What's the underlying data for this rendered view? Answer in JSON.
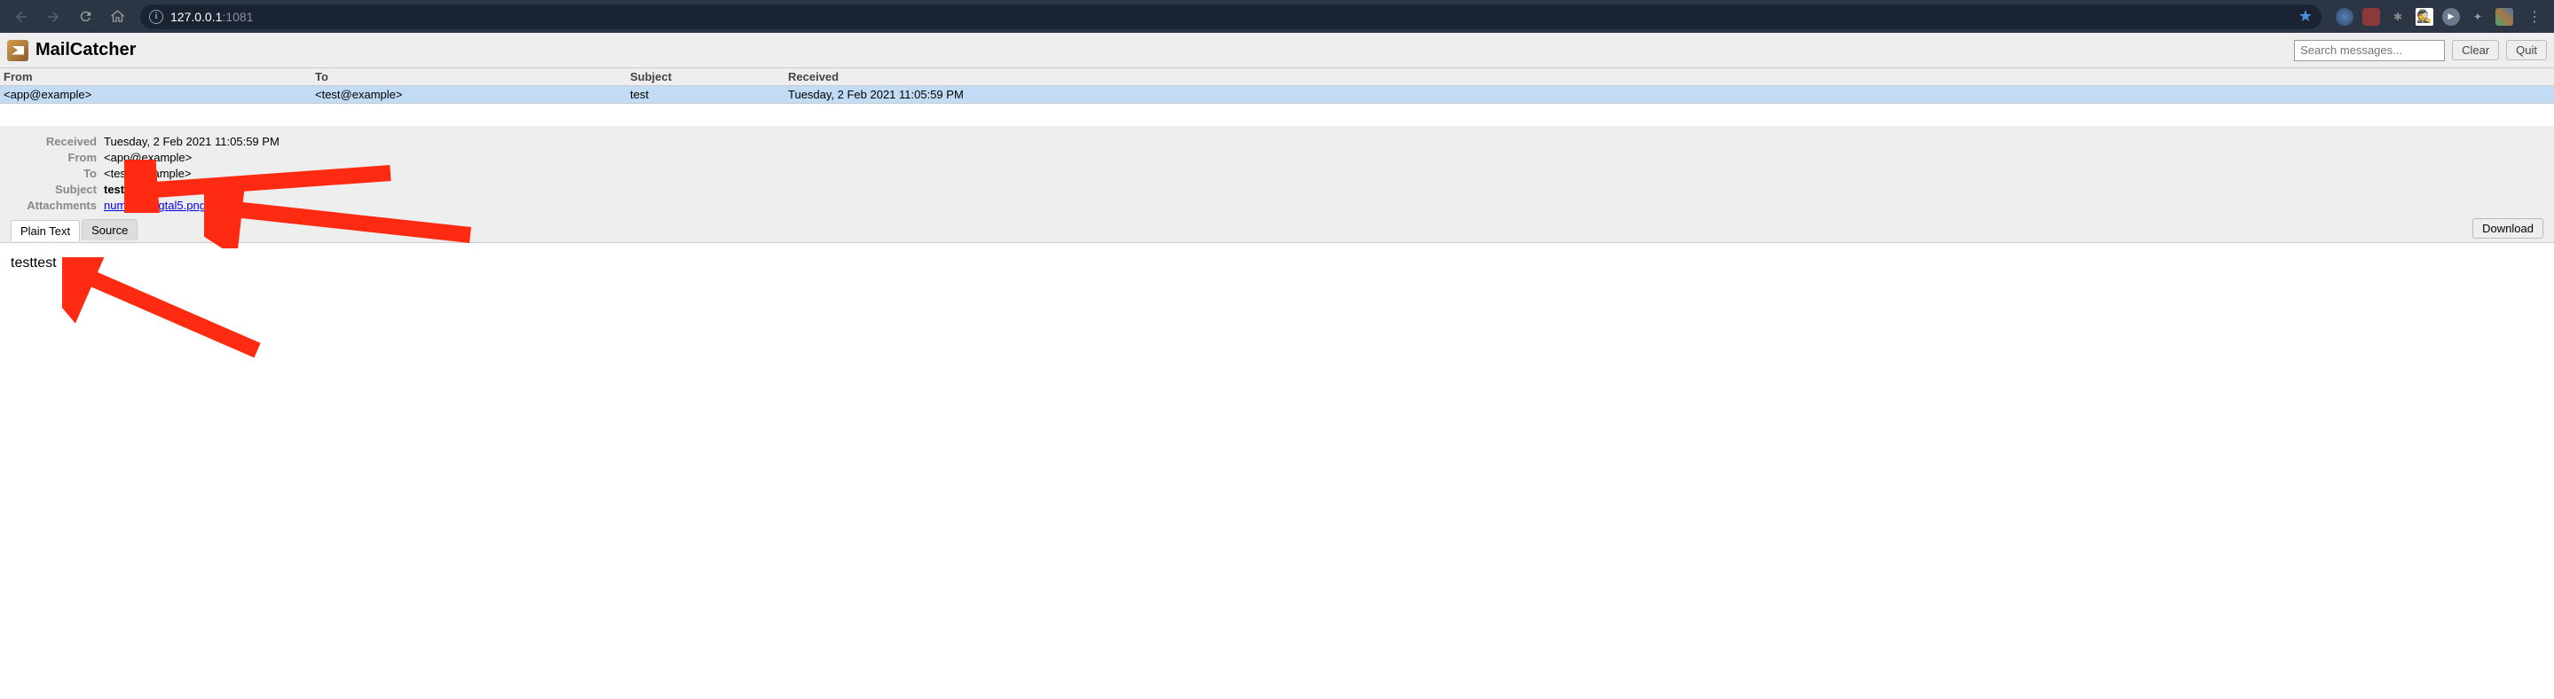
{
  "browser": {
    "url_host": "127.0.0.1",
    "url_port": ":1081"
  },
  "app": {
    "title": "MailCatcher",
    "search_placeholder": "Search messages...",
    "clear_label": "Clear",
    "quit_label": "Quit"
  },
  "columns": {
    "from": "From",
    "to": "To",
    "subject": "Subject",
    "received": "Received"
  },
  "messages": [
    {
      "from": "<app@example>",
      "to": "<test@example>",
      "subject": "test",
      "received": "Tuesday, 2 Feb 2021 11:05:59 PM"
    }
  ],
  "detail": {
    "labels": {
      "received": "Received",
      "from": "From",
      "to": "To",
      "subject": "Subject",
      "attachments": "Attachments"
    },
    "received": "Tuesday, 2 Feb 2021 11:05:59 PM",
    "from": "<app@example>",
    "to": "<test@example>",
    "subject": "test",
    "attachment": "number_digtal5.png"
  },
  "tabs": {
    "plain_text": "Plain Text",
    "source": "Source",
    "download": "Download"
  },
  "body": "testtest"
}
